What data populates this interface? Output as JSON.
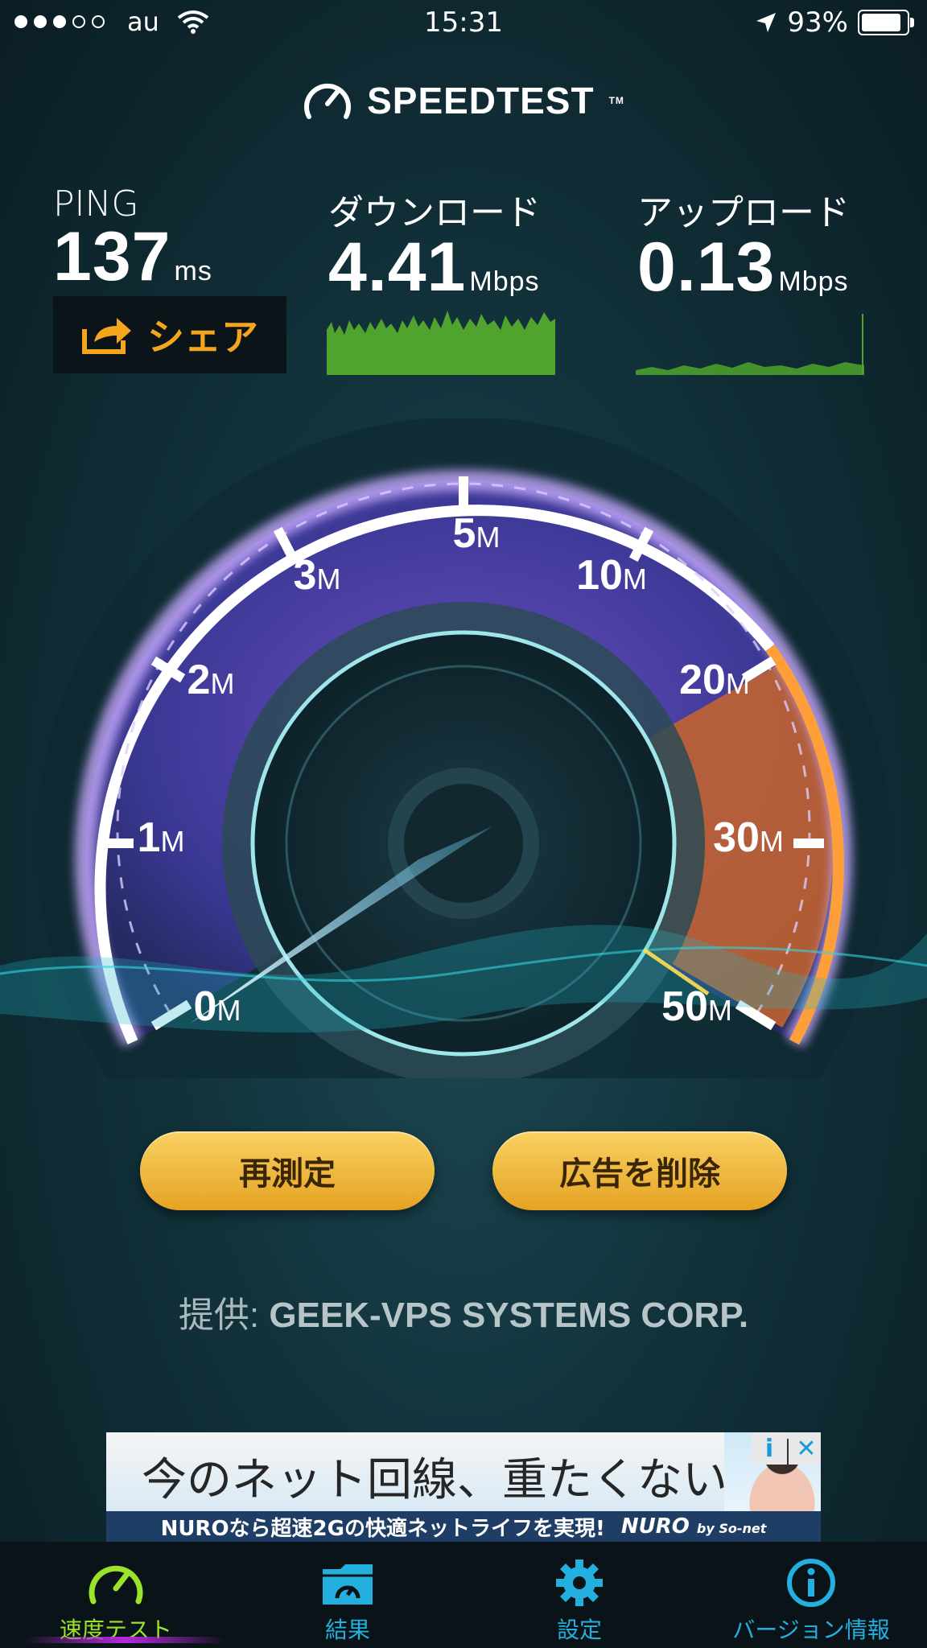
{
  "status_bar": {
    "carrier": "au",
    "time": "15:31",
    "battery": "93%",
    "battery_level": 0.93
  },
  "app": {
    "logo": "SPEEDTEST",
    "trademark": "TM"
  },
  "metrics": {
    "ping": {
      "label": "PING",
      "value": "137",
      "unit": "ms"
    },
    "download": {
      "label": "ダウンロード",
      "value": "4.41",
      "unit": "Mbps"
    },
    "upload": {
      "label": "アップロード",
      "value": "0.13",
      "unit": "Mbps"
    }
  },
  "share_label": "シェア",
  "gauge": {
    "ticks": [
      {
        "num": "0",
        "unit": "M"
      },
      {
        "num": "1",
        "unit": "M"
      },
      {
        "num": "2",
        "unit": "M"
      },
      {
        "num": "3",
        "unit": "M"
      },
      {
        "num": "5",
        "unit": "M"
      },
      {
        "num": "10",
        "unit": "M"
      },
      {
        "num": "20",
        "unit": "M"
      },
      {
        "num": "30",
        "unit": "M"
      },
      {
        "num": "50",
        "unit": "M"
      }
    ]
  },
  "buttons": {
    "retest": "再測定",
    "remove_ads": "広告を削除"
  },
  "provider": {
    "prefix": "提供:",
    "name": "GEEK-VPS SYSTEMS CORP."
  },
  "ad": {
    "headline": "今のネット回線、重たくない?",
    "subline": "NUROなら超速2Gの快適ネットライフを実現!",
    "brand": "NURO",
    "brand_suffix": "by So-net",
    "info_icon": "i",
    "close_icon": "✕"
  },
  "tabs": [
    {
      "label": "速度テスト",
      "icon": "speedometer-icon",
      "color": "#9be32a"
    },
    {
      "label": "結果",
      "icon": "folder-icon",
      "color": "#23b0df"
    },
    {
      "label": "設定",
      "icon": "gear-icon",
      "color": "#23b0df"
    },
    {
      "label": "バージョン情報",
      "icon": "info-icon",
      "color": "#23b0df"
    }
  ]
}
